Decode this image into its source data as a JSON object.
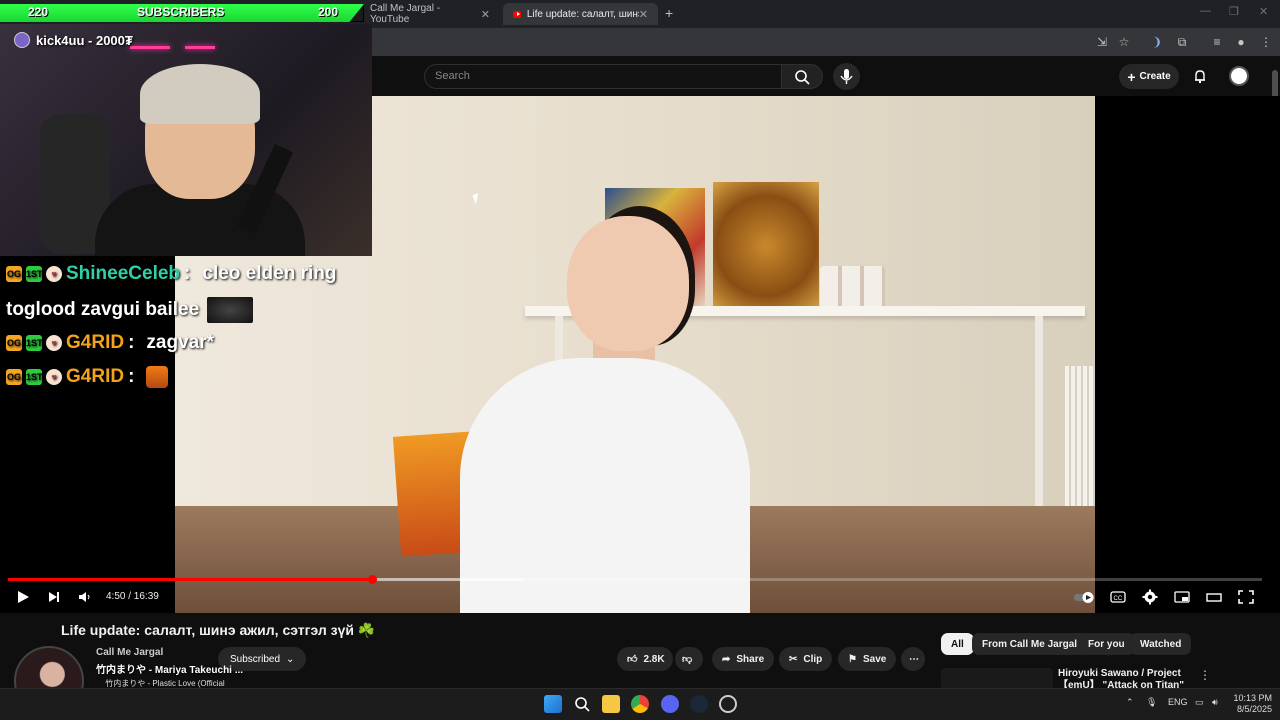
{
  "browser": {
    "tabs": [
      {
        "label": "Call Me Jargal - YouTube",
        "active": false
      },
      {
        "label": "Life update: салалт, шинэ ажил",
        "active": true
      }
    ],
    "new_tab_symbol": "+"
  },
  "youtube": {
    "search_placeholder": "Search",
    "create_label": "Create",
    "video": {
      "title": "Life update: салалт, шинэ ажил, сэтгэл зүй ☘️",
      "current_time": "4:50",
      "duration": "16:39",
      "time_display": "4:50 / 16:39",
      "progress_fraction": 0.29,
      "buffer_fraction": 0.41
    },
    "channel": {
      "name": "Call Me Jargal",
      "subscribe_state": "Subscribed"
    },
    "actions": {
      "likes": "2.8K",
      "share": "Share",
      "clip": "Clip",
      "save": "Save"
    },
    "chips": [
      "All",
      "From Call Me Jargal",
      "For you",
      "Watched"
    ],
    "recommendation": {
      "title": "Hiroyuki Sawano / Project 【emU】 \"Attack on Titan\" suite"
    }
  },
  "stream_overlay": {
    "subs_bar": {
      "left": "220",
      "label": "SUBSCRIBERS",
      "right": "200"
    },
    "kick_alert": "kick4uu - 2000₮",
    "chat": [
      {
        "user": "ShineeCeleb",
        "message": "cleo elden ring",
        "message2": "toglood zavgui bailee",
        "user_color": "#2fd0a8"
      },
      {
        "user": "G4RID",
        "message": "zagvar*",
        "user_color": "#f3a21a"
      },
      {
        "user": "G4RID",
        "message": "",
        "user_color": "#f3a21a"
      }
    ],
    "badges": {
      "og": "OG",
      "first": "1ST"
    }
  },
  "now_playing": {
    "title": "竹内まりや - Mariya Takeuchi ...",
    "subtitle": "竹内まりや - Plastic Love (Official Music Video)"
  },
  "taskbar": {
    "language": "ENG",
    "time": "10:13 PM",
    "date": "8/5/2025"
  },
  "colors": {
    "accent_red": "#ff0000",
    "sub_bar_green": "#2fff4a",
    "yt_bg": "#0f0f0f"
  }
}
